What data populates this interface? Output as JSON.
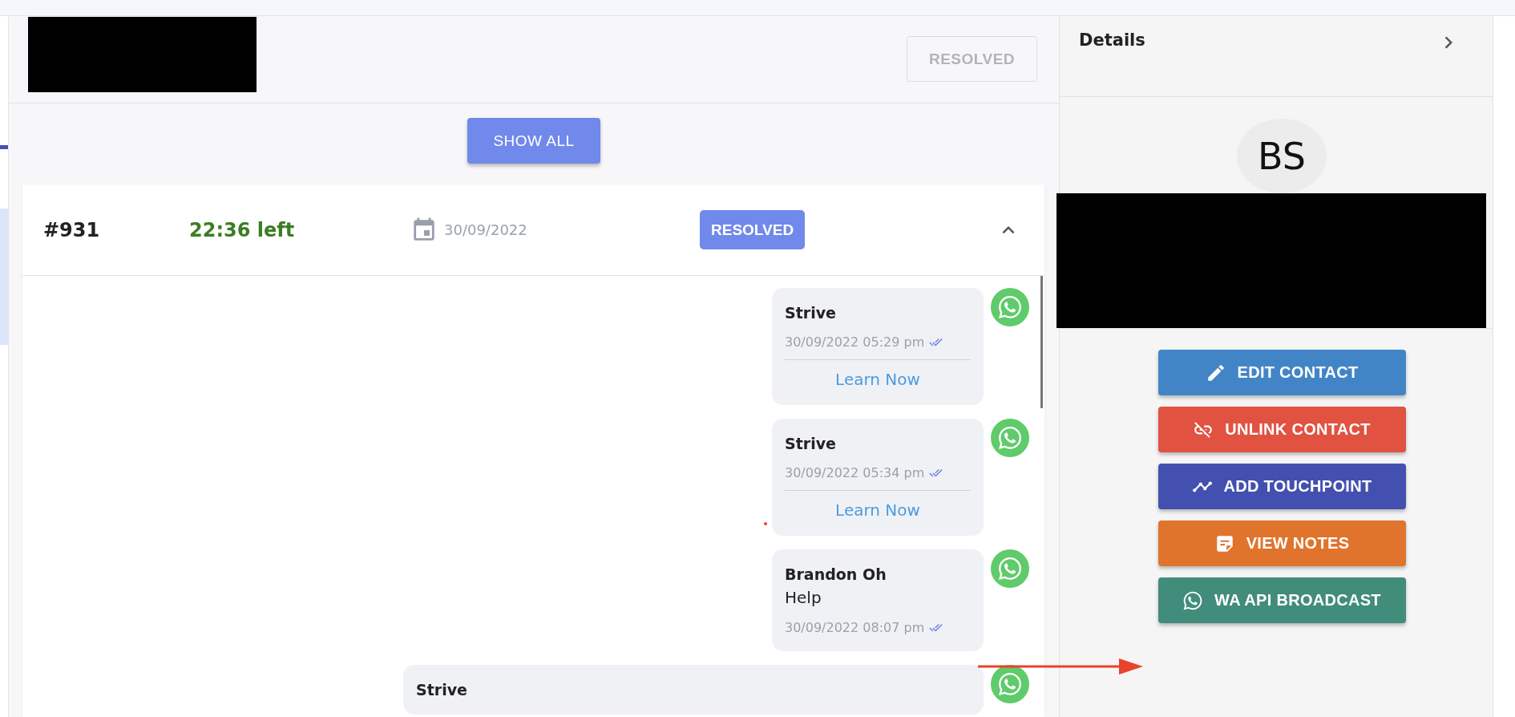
{
  "header": {
    "status_button": "RESOLVED"
  },
  "show_all_button": "SHOW ALL",
  "ticket": {
    "number": "#931",
    "time_left": "22:36 left",
    "date": "30/09/2022",
    "status": "RESOLVED",
    "expanded": true
  },
  "messages": [
    {
      "sender": "Strive",
      "time": "30/09/2022 05:29 pm",
      "link": "Learn Now"
    },
    {
      "sender": "Strive",
      "time": "30/09/2022 05:34 pm",
      "link": "Learn Now"
    },
    {
      "sender": "Brandon Oh",
      "body": "Help",
      "time": "30/09/2022 08:07 pm"
    },
    {
      "sender": "Strive"
    }
  ],
  "details": {
    "title": "Details",
    "initials": "BS",
    "actions": [
      {
        "label": "EDIT CONTACT",
        "kind": "edit",
        "color": "#4285c6"
      },
      {
        "label": "UNLINK CONTACT",
        "kind": "unlink",
        "color": "#e15241"
      },
      {
        "label": "ADD TOUCHPOINT",
        "kind": "touchpoint",
        "color": "#4350af"
      },
      {
        "label": "VIEW NOTES",
        "kind": "notes",
        "color": "#e0742c"
      },
      {
        "label": "WA API BROADCAST",
        "kind": "whatsapp",
        "color": "#428c7c"
      }
    ]
  }
}
